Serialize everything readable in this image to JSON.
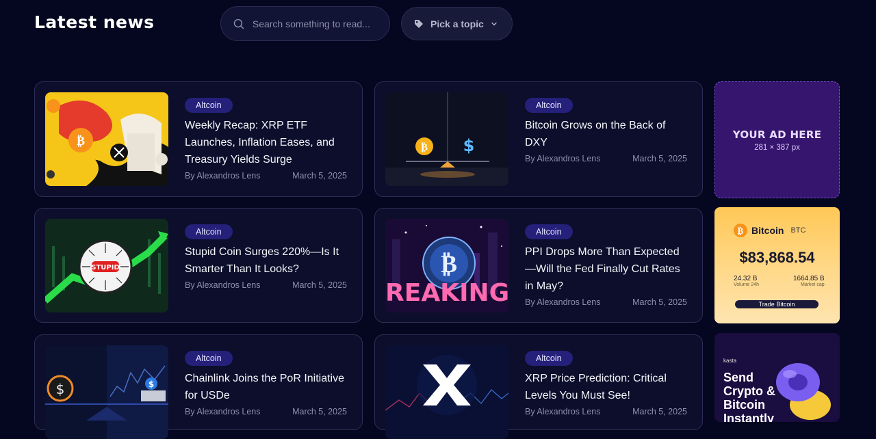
{
  "header": {
    "title": "Latest news",
    "search_placeholder": "Search something to read...",
    "topic_label": "Pick a topic"
  },
  "articles": [
    {
      "badge": "Altcoin",
      "title": "Weekly Recap: XRP ETF Launches, Inflation Eases, and Treasury Yields Surge",
      "author": "By Alexandros Lens",
      "date": "March 5, 2025"
    },
    {
      "badge": "Altcoin",
      "title": "Bitcoin Grows on the Back of DXY",
      "author": "By Alexandros Lens",
      "date": "March 5, 2025"
    },
    {
      "badge": "Altcoin",
      "title": "Stupid Coin Surges 220%—Is It Smarter Than It Looks?",
      "author": "By Alexandros Lens",
      "date": "March 5, 2025"
    },
    {
      "badge": "Altcoin",
      "title": "PPI Drops More Than Expected—Will the Fed Finally Cut Rates in May?",
      "author": "By Alexandros Lens",
      "date": "March 5, 2025"
    },
    {
      "badge": "Altcoin",
      "title": "Chainlink Joins the PoR Initiative for USDe",
      "author": "By Alexandros Lens",
      "date": "March 5, 2025"
    },
    {
      "badge": "Altcoin",
      "title": "XRP Price Prediction: Critical Levels You Must See!",
      "author": "By Alexandros Lens",
      "date": "March 5, 2025"
    }
  ],
  "thumb_text": {
    "stupid": "STUPID",
    "breaking": "REAKING"
  },
  "ad_placeholder": {
    "title": "YOUR AD HERE",
    "size": "281 × 387 px"
  },
  "bitcoin_widget": {
    "name": "Bitcoin",
    "symbol": "BTC",
    "price": "$83,868.54",
    "volume": "24.32 B",
    "volume_label": "Volume 24h",
    "market_cap": "1664.85 B",
    "market_cap_label": "Market cap",
    "button": "Trade Bitcoin"
  },
  "kasta_ad": {
    "brand": "kasta",
    "line1": "Send",
    "line2": "Crypto &",
    "line3": "Bitcoin",
    "line4": "Instantly"
  },
  "colors": {
    "background": "#05061f",
    "card": "#0c0e2b",
    "badge": "#25207a",
    "ad_purple": "#36156e",
    "bitcoin_orange": "#f7931a"
  },
  "icons": {
    "search": "search-icon",
    "topic": "tag-icon",
    "dropdown": "chevron-down-icon"
  }
}
